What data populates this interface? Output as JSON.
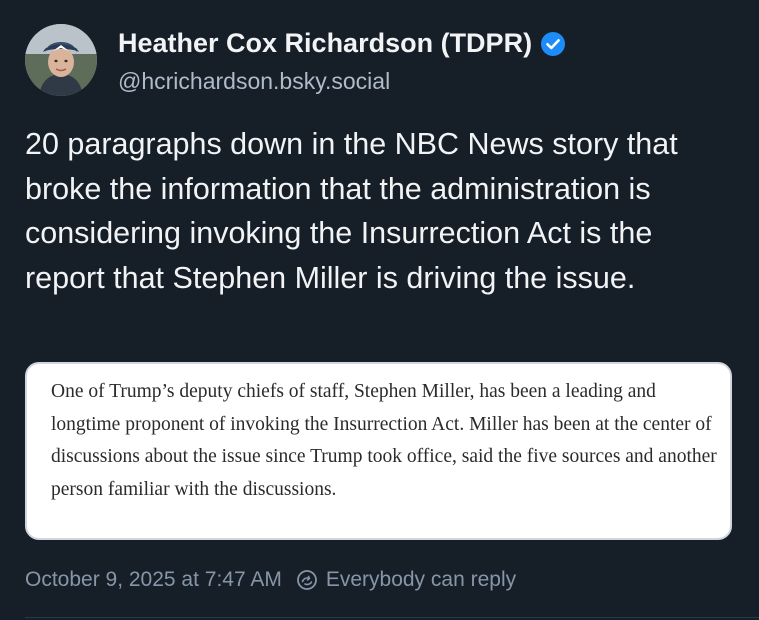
{
  "author": {
    "display_name": "Heather Cox Richardson (TDPR)",
    "handle": "@hcrichardson.bsky.social",
    "verified": true,
    "avatar_icon": "profile-photo"
  },
  "post": {
    "text": "20 paragraphs down in the NBC News story that broke the information that the administration is considering invoking the Insurrection Act is the report that Stephen Miller is driving the issue.",
    "quote_image_text": "One of Trump’s deputy chiefs of staff, Stephen Miller, has been a leading and longtime proponent of invoking the Insurrection Act. Miller has been at the center of discussions about the issue since Trump took office, said the five sources and another person familiar with the discussions."
  },
  "meta": {
    "timestamp": "October 9, 2025 at 7:47 AM",
    "reply_setting": "Everybody can reply",
    "reply_icon": "globe-reply-icon"
  },
  "colors": {
    "background": "#161e27",
    "primary_text": "#f1f3f5",
    "secondary_text": "#aebbc9",
    "meta_text": "#8696a8",
    "verified_badge": "#1d8cf8",
    "card_background": "#ffffff"
  }
}
